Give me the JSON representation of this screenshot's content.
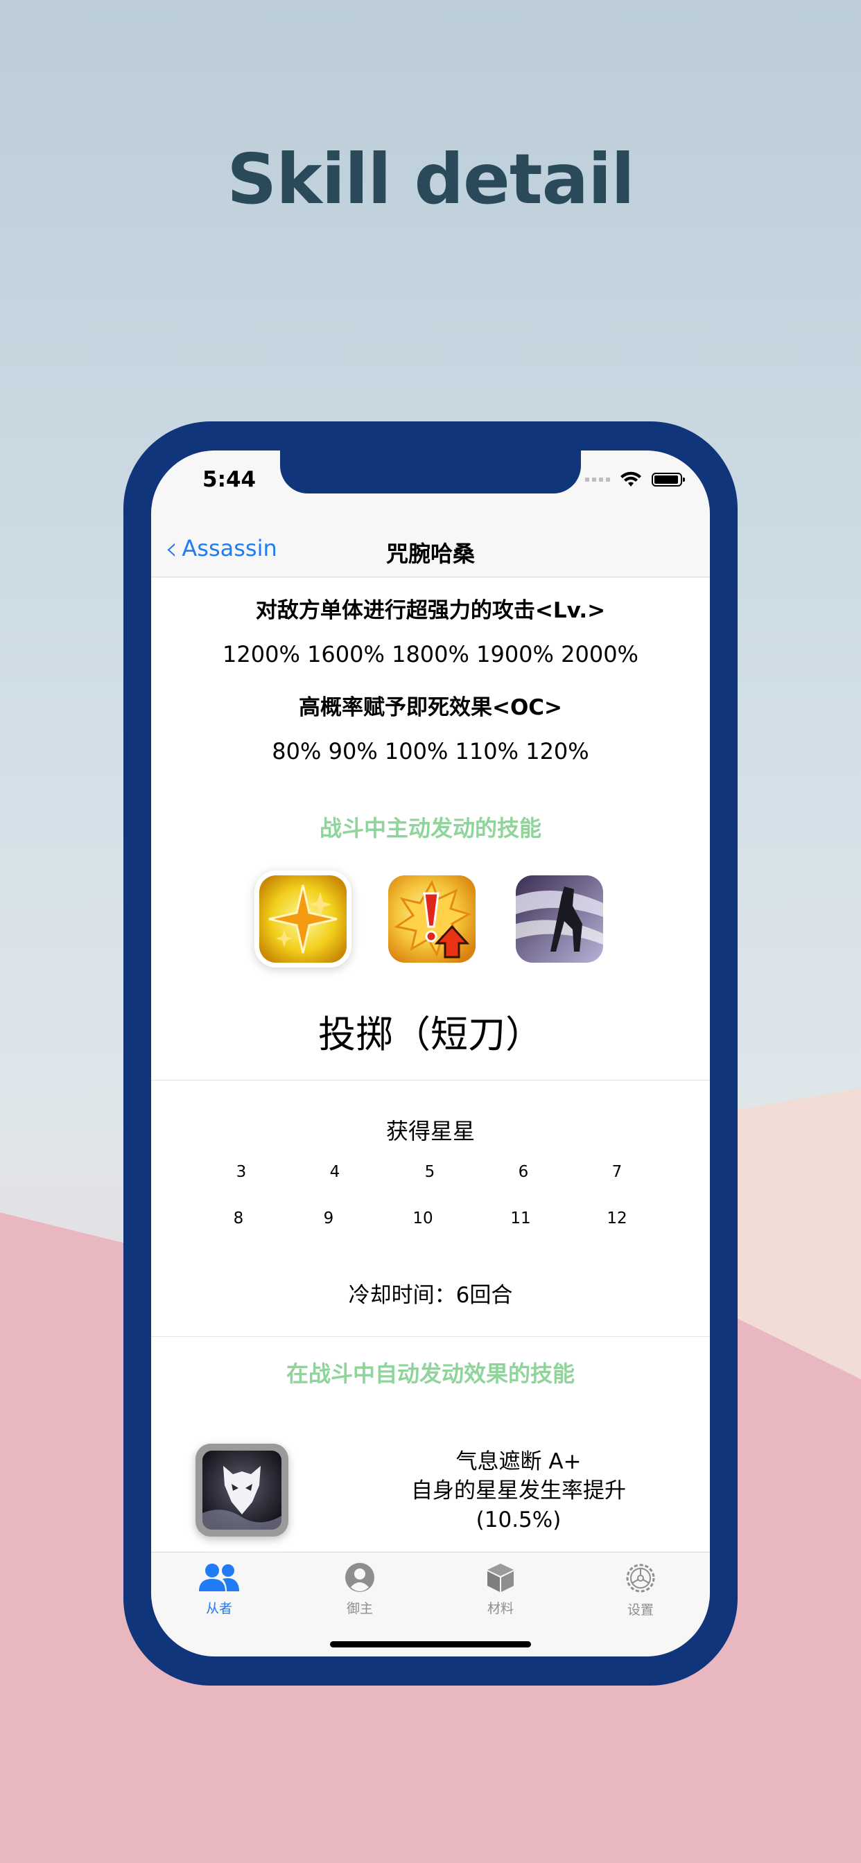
{
  "headline": "Skill detail",
  "status": {
    "time": "5:44"
  },
  "nav": {
    "back_label": "Assassin",
    "title": "咒腕哈桑"
  },
  "effects": {
    "line1": "对敌方单体进行超强力的攻击<Lv.>",
    "line1_values": "1200%  1600%  1800%  1900%  2000%",
    "line2": "高概率赋予即死效果<OC>",
    "line2_values": "80%  90%  100%  110%  120%"
  },
  "active_section_title": "战斗中主动发动的技能",
  "card_icons": [
    "quick-card-icon",
    "buster-up-icon",
    "assassin-skill-icon"
  ],
  "skill_name": "投掷（短刀）",
  "stars": {
    "label": "获得星星",
    "row1": [
      "3",
      "4",
      "5",
      "6",
      "7"
    ],
    "row2": [
      "8",
      "9",
      "10",
      "11",
      "12"
    ]
  },
  "cooldown": "冷却时间：6回合",
  "passive_section_title": "在战斗中自动发动效果的技能",
  "passive": {
    "name": "气息遮断 A+",
    "desc": "自身的星星发生率提升",
    "value": "(10.5%)"
  },
  "tabs": [
    {
      "label": "从者",
      "icon": "people-icon",
      "active": true
    },
    {
      "label": "御主",
      "icon": "person-circle-icon",
      "active": false
    },
    {
      "label": "材料",
      "icon": "box-icon",
      "active": false
    },
    {
      "label": "设置",
      "icon": "gear-icon",
      "active": false
    }
  ],
  "colors": {
    "accent": "#1f7cf4",
    "section_title": "#8fd49a",
    "device_frame": "#10357a",
    "headline": "#2a4a5a"
  }
}
